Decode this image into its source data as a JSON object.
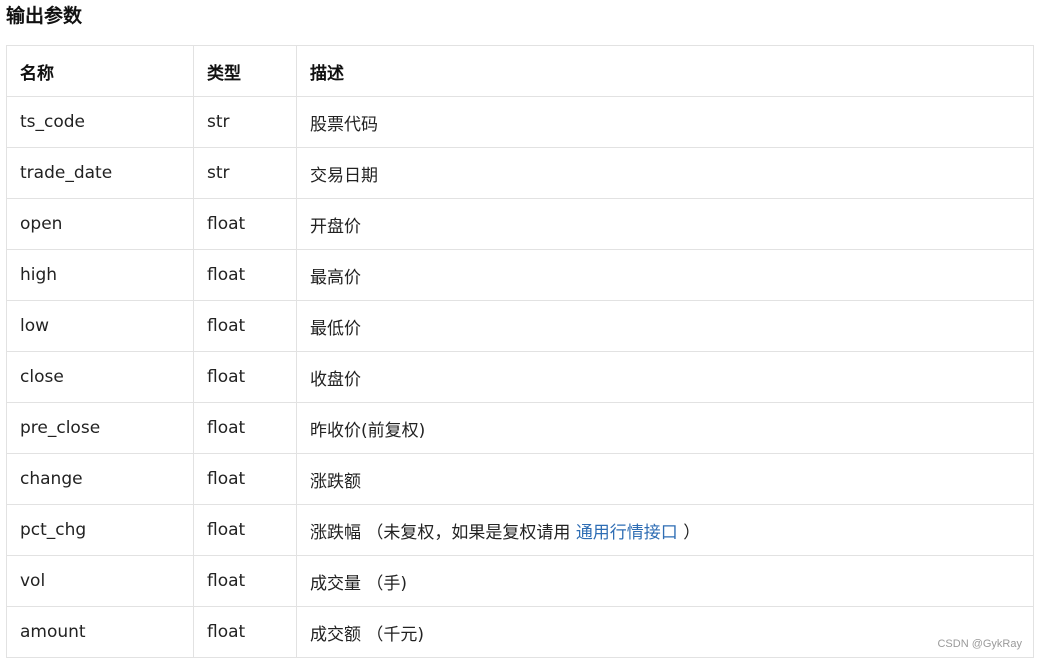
{
  "section_title": "输出参数",
  "table": {
    "headers": {
      "name": "名称",
      "type": "类型",
      "desc": "描述"
    },
    "rows": [
      {
        "name": "ts_code",
        "type": "str",
        "desc": "股票代码"
      },
      {
        "name": "trade_date",
        "type": "str",
        "desc": "交易日期"
      },
      {
        "name": "open",
        "type": "float",
        "desc": "开盘价"
      },
      {
        "name": "high",
        "type": "float",
        "desc": "最高价"
      },
      {
        "name": "low",
        "type": "float",
        "desc": "最低价"
      },
      {
        "name": "close",
        "type": "float",
        "desc": "收盘价"
      },
      {
        "name": "pre_close",
        "type": "float",
        "desc": "昨收价(前复权)"
      },
      {
        "name": "change",
        "type": "float",
        "desc": "涨跌额"
      },
      {
        "name": "pct_chg",
        "type": "float",
        "desc": "涨跌幅 ",
        "note_pre": "（未复权，如果是复权请用 ",
        "link": "通用行情接口",
        "note_post": " ）"
      },
      {
        "name": "vol",
        "type": "float",
        "desc": "成交量 （手)"
      },
      {
        "name": "amount",
        "type": "float",
        "desc": "成交额 （千元)"
      }
    ]
  },
  "link_color": "#2e6db4",
  "watermark": "CSDN @GykRay"
}
